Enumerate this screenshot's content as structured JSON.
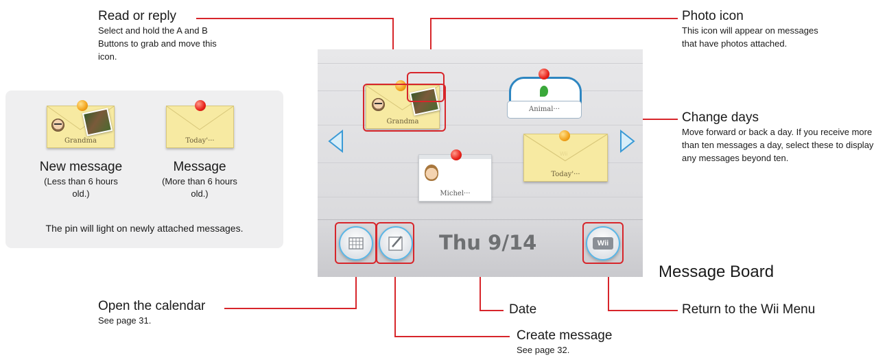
{
  "callouts": {
    "read_reply": {
      "title": "Read or reply",
      "desc": "Select and hold the A and B Buttons to grab and move this icon."
    },
    "photo_icon": {
      "title": "Photo icon",
      "desc": "This icon will appear on messages that have photos attached."
    },
    "change_days": {
      "title": "Change days",
      "desc": "Move forward or back a day. If you receive more than ten messages a day, select these to display any messages beyond ten."
    },
    "open_calendar": {
      "title": "Open the calendar",
      "desc": "See page 31."
    },
    "date": {
      "title": "Date"
    },
    "create_message": {
      "title": "Create message",
      "desc": "See page 32."
    },
    "return_wii": {
      "title": "Return to the Wii Menu"
    }
  },
  "legend": {
    "new_message": {
      "envelope_name": "Grandma",
      "title": "New message",
      "sub": "(Less than 6 hours old.)",
      "pin_color": "#f2a31c"
    },
    "message": {
      "envelope_name": "Today'···",
      "title": "Message",
      "sub": "(More than 6 hours old.)",
      "pin_color": "#e8221a"
    },
    "note": "The pin will light on newly attached messages."
  },
  "screen": {
    "caption": "Message Board",
    "date": "Thu 9/14",
    "wii_label": "Wii",
    "envelope_label": "Wii",
    "messages": [
      {
        "name": "Grandma",
        "kind": "photo-envelope",
        "icon": "mii-face-icon"
      },
      {
        "name": "Animal···",
        "kind": "animal-crossing-tag",
        "icon": "leaf-icon"
      },
      {
        "name": "Today'···",
        "kind": "envelope"
      },
      {
        "name": "Michel···",
        "kind": "mii-card",
        "icon": "mii-face-icon"
      }
    ]
  },
  "colors": {
    "callout_red": "#d7252a",
    "button_ring": "#5ab6e6",
    "arrow_blue": "#3a9ad6"
  }
}
